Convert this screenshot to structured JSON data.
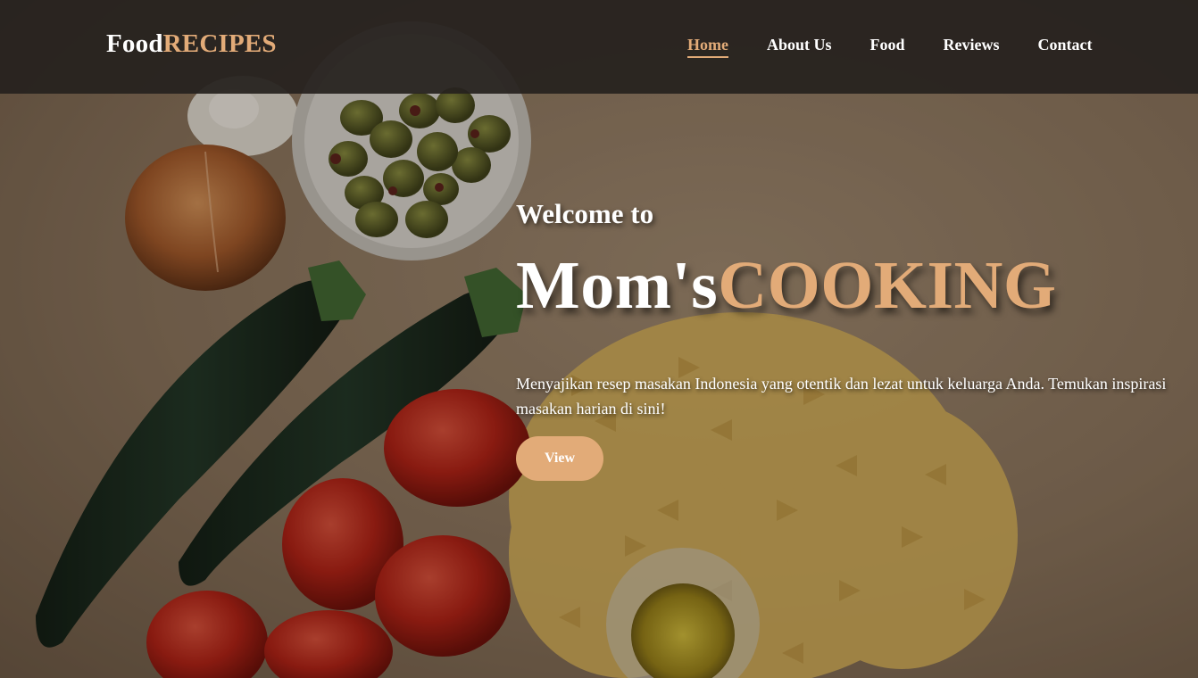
{
  "brand": {
    "primary": "Food",
    "accent": "RECIPES"
  },
  "nav": {
    "items": [
      {
        "label": "Home",
        "active": true
      },
      {
        "label": "About Us",
        "active": false
      },
      {
        "label": "Food",
        "active": false
      },
      {
        "label": "Reviews",
        "active": false
      },
      {
        "label": "Contact",
        "active": false
      }
    ]
  },
  "hero": {
    "welcome": "Welcome to",
    "title_main": "Mom's",
    "title_accent": "COOKING",
    "description": "Menyajikan resep masakan Indonesia yang otentik dan lezat untuk keluarga Anda. Temukan inspirasi masakan harian di sini!",
    "button_label": "View"
  },
  "colors": {
    "accent": "#e2ab78",
    "header_bg": "#26211e",
    "text": "#ffffff"
  }
}
